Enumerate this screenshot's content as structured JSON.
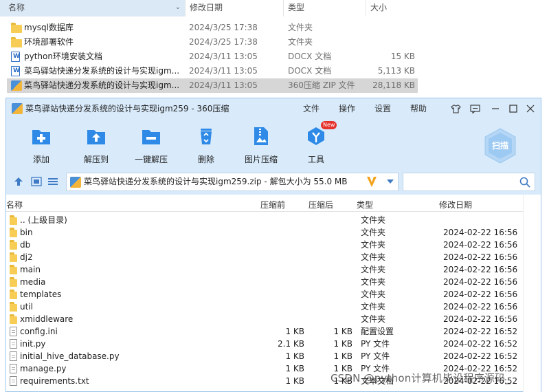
{
  "explorer": {
    "headers": {
      "name": "名称",
      "date": "修改日期",
      "type": "类型",
      "size": "大小"
    },
    "rows": [
      {
        "name": "mysql数据库",
        "date": "2024/3/25 17:38",
        "type": "文件夹",
        "size": "",
        "icon": "folder-icon"
      },
      {
        "name": "环境部署软件",
        "date": "2024/3/25 17:38",
        "type": "文件夹",
        "size": "",
        "icon": "folder-icon"
      },
      {
        "name": "python环境安装文档",
        "date": "2024/3/11 13:05",
        "type": "DOCX 文档",
        "size": "15 KB",
        "icon": "docx-icon"
      },
      {
        "name": "菜鸟驿站快递分发系统的设计与实现igm...",
        "date": "2024/3/11 13:05",
        "type": "DOCX 文档",
        "size": "5,113 KB",
        "icon": "docx-icon"
      },
      {
        "name": "菜鸟驿站快递分发系统的设计与实现igm...",
        "date": "2024/3/11 13:05",
        "type": "360压缩 ZIP 文件",
        "size": "28,118 KB",
        "icon": "zip-icon",
        "selected": true
      }
    ]
  },
  "zipwin": {
    "title": "菜鸟驿站快递分发系统的设计与实现igm259 - 360压缩",
    "menus": {
      "file": "文件",
      "action": "操作",
      "settings": "设置",
      "help": "帮助"
    },
    "toolbar": {
      "add": "添加",
      "extract_to": "解压到",
      "one_click": "一键解压",
      "delete": "删除",
      "image_compress": "图片压缩",
      "tools": "工具",
      "new_badge": "New",
      "scan": "扫描"
    },
    "address": "菜鸟驿站快递分发系统的设计与实现igm259.zip - 解包大小为 55.0 MB",
    "search_placeholder": "",
    "columns": {
      "name": "名称",
      "compressed_before": "压缩前",
      "compressed_after": "压缩后",
      "type": "类型",
      "modified": "修改日期"
    },
    "files": [
      {
        "name": ".. (上级目录)",
        "before": "",
        "after": "",
        "type": "文件夹",
        "date": "",
        "icon": "folder-icon"
      },
      {
        "name": "bin",
        "before": "",
        "after": "",
        "type": "文件夹",
        "date": "2024-02-22 16:56",
        "icon": "folder-icon"
      },
      {
        "name": "db",
        "before": "",
        "after": "",
        "type": "文件夹",
        "date": "2024-02-22 16:56",
        "icon": "folder-icon"
      },
      {
        "name": "dj2",
        "before": "",
        "after": "",
        "type": "文件夹",
        "date": "2024-02-22 16:56",
        "icon": "folder-icon"
      },
      {
        "name": "main",
        "before": "",
        "after": "",
        "type": "文件夹",
        "date": "2024-02-22 16:56",
        "icon": "folder-icon"
      },
      {
        "name": "media",
        "before": "",
        "after": "",
        "type": "文件夹",
        "date": "2024-02-22 16:56",
        "icon": "folder-icon"
      },
      {
        "name": "templates",
        "before": "",
        "after": "",
        "type": "文件夹",
        "date": "2024-02-22 16:56",
        "icon": "folder-icon"
      },
      {
        "name": "util",
        "before": "",
        "after": "",
        "type": "文件夹",
        "date": "2024-02-22 16:56",
        "icon": "folder-icon"
      },
      {
        "name": "xmiddleware",
        "before": "",
        "after": "",
        "type": "文件夹",
        "date": "2024-02-22 16:56",
        "icon": "folder-icon"
      },
      {
        "name": "config.ini",
        "before": "1 KB",
        "after": "1 KB",
        "type": "配置设置",
        "date": "2024-02-22 16:52",
        "icon": "file-icon"
      },
      {
        "name": "init.py",
        "before": "2.1 KB",
        "after": "1 KB",
        "type": "PY 文件",
        "date": "2024-02-22 16:52",
        "icon": "file-icon"
      },
      {
        "name": "initial_hive_database.py",
        "before": "1 KB",
        "after": "1 KB",
        "type": "PY 文件",
        "date": "2024-02-22 16:52",
        "icon": "file-icon"
      },
      {
        "name": "manage.py",
        "before": "1 KB",
        "after": "1 KB",
        "type": "PY 文件",
        "date": "2024-02-22 16:52",
        "icon": "file-icon"
      },
      {
        "name": "requirements.txt",
        "before": "1 KB",
        "after": "1 KB",
        "type": "文本文档",
        "date": "2024-02-22 16:52",
        "icon": "file-icon"
      }
    ]
  },
  "watermark": "CSDN @python计算机毕设程序源码_",
  "colors": {
    "window_bg": "#d9ebfb",
    "accent": "#2e8ae6",
    "selected_row": "#d6d6d6"
  }
}
